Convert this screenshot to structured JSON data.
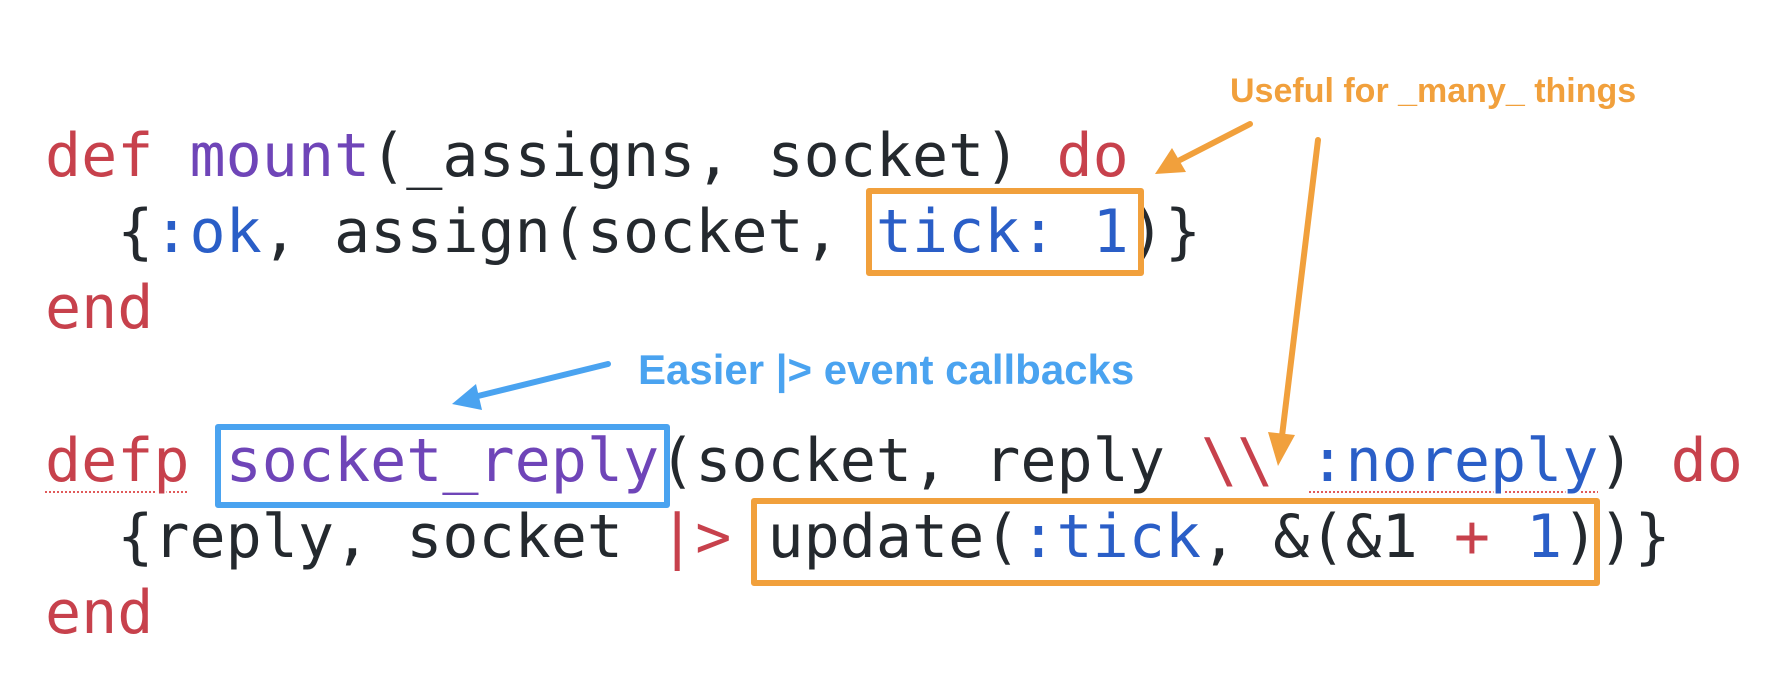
{
  "annotations": {
    "many_things": "Useful for _many_ things",
    "callbacks": "Easier |> event callbacks"
  },
  "code": {
    "line1": {
      "kw_def": "def",
      "fn_mount": "mount",
      "args": "(_assigns, socket)",
      "kw_do": "do"
    },
    "line2": {
      "open": "{",
      "atom_ok": ":ok",
      "middle": ", assign(socket, ",
      "tick": "tick: 1",
      "close": ")}"
    },
    "line3": {
      "kw_end": "end"
    },
    "line4": {
      "kw_defp": "defp",
      "fn_socket_reply": "socket_reply",
      "args_start": "(socket, reply ",
      "op_default": "\\\\",
      "atom_noreply": ":noreply",
      "args_close": ")",
      "kw_do": "do"
    },
    "line5": {
      "start": "{reply, socket ",
      "op_pipe": "|>",
      "update": "update(",
      "atom_tick": ":tick",
      "capture": ", &(&1 ",
      "op_plus": "+",
      "num_one": "1",
      "close_inner": ")",
      "close_outer": ")}"
    },
    "line6": {
      "kw_end": "end"
    }
  },
  "colors": {
    "keyword": "#c7414c",
    "function": "#6f45b8",
    "atom": "#2a5ec7",
    "text": "#24292e",
    "highlight_orange": "#f1a03c",
    "highlight_blue": "#4aa3f0"
  }
}
